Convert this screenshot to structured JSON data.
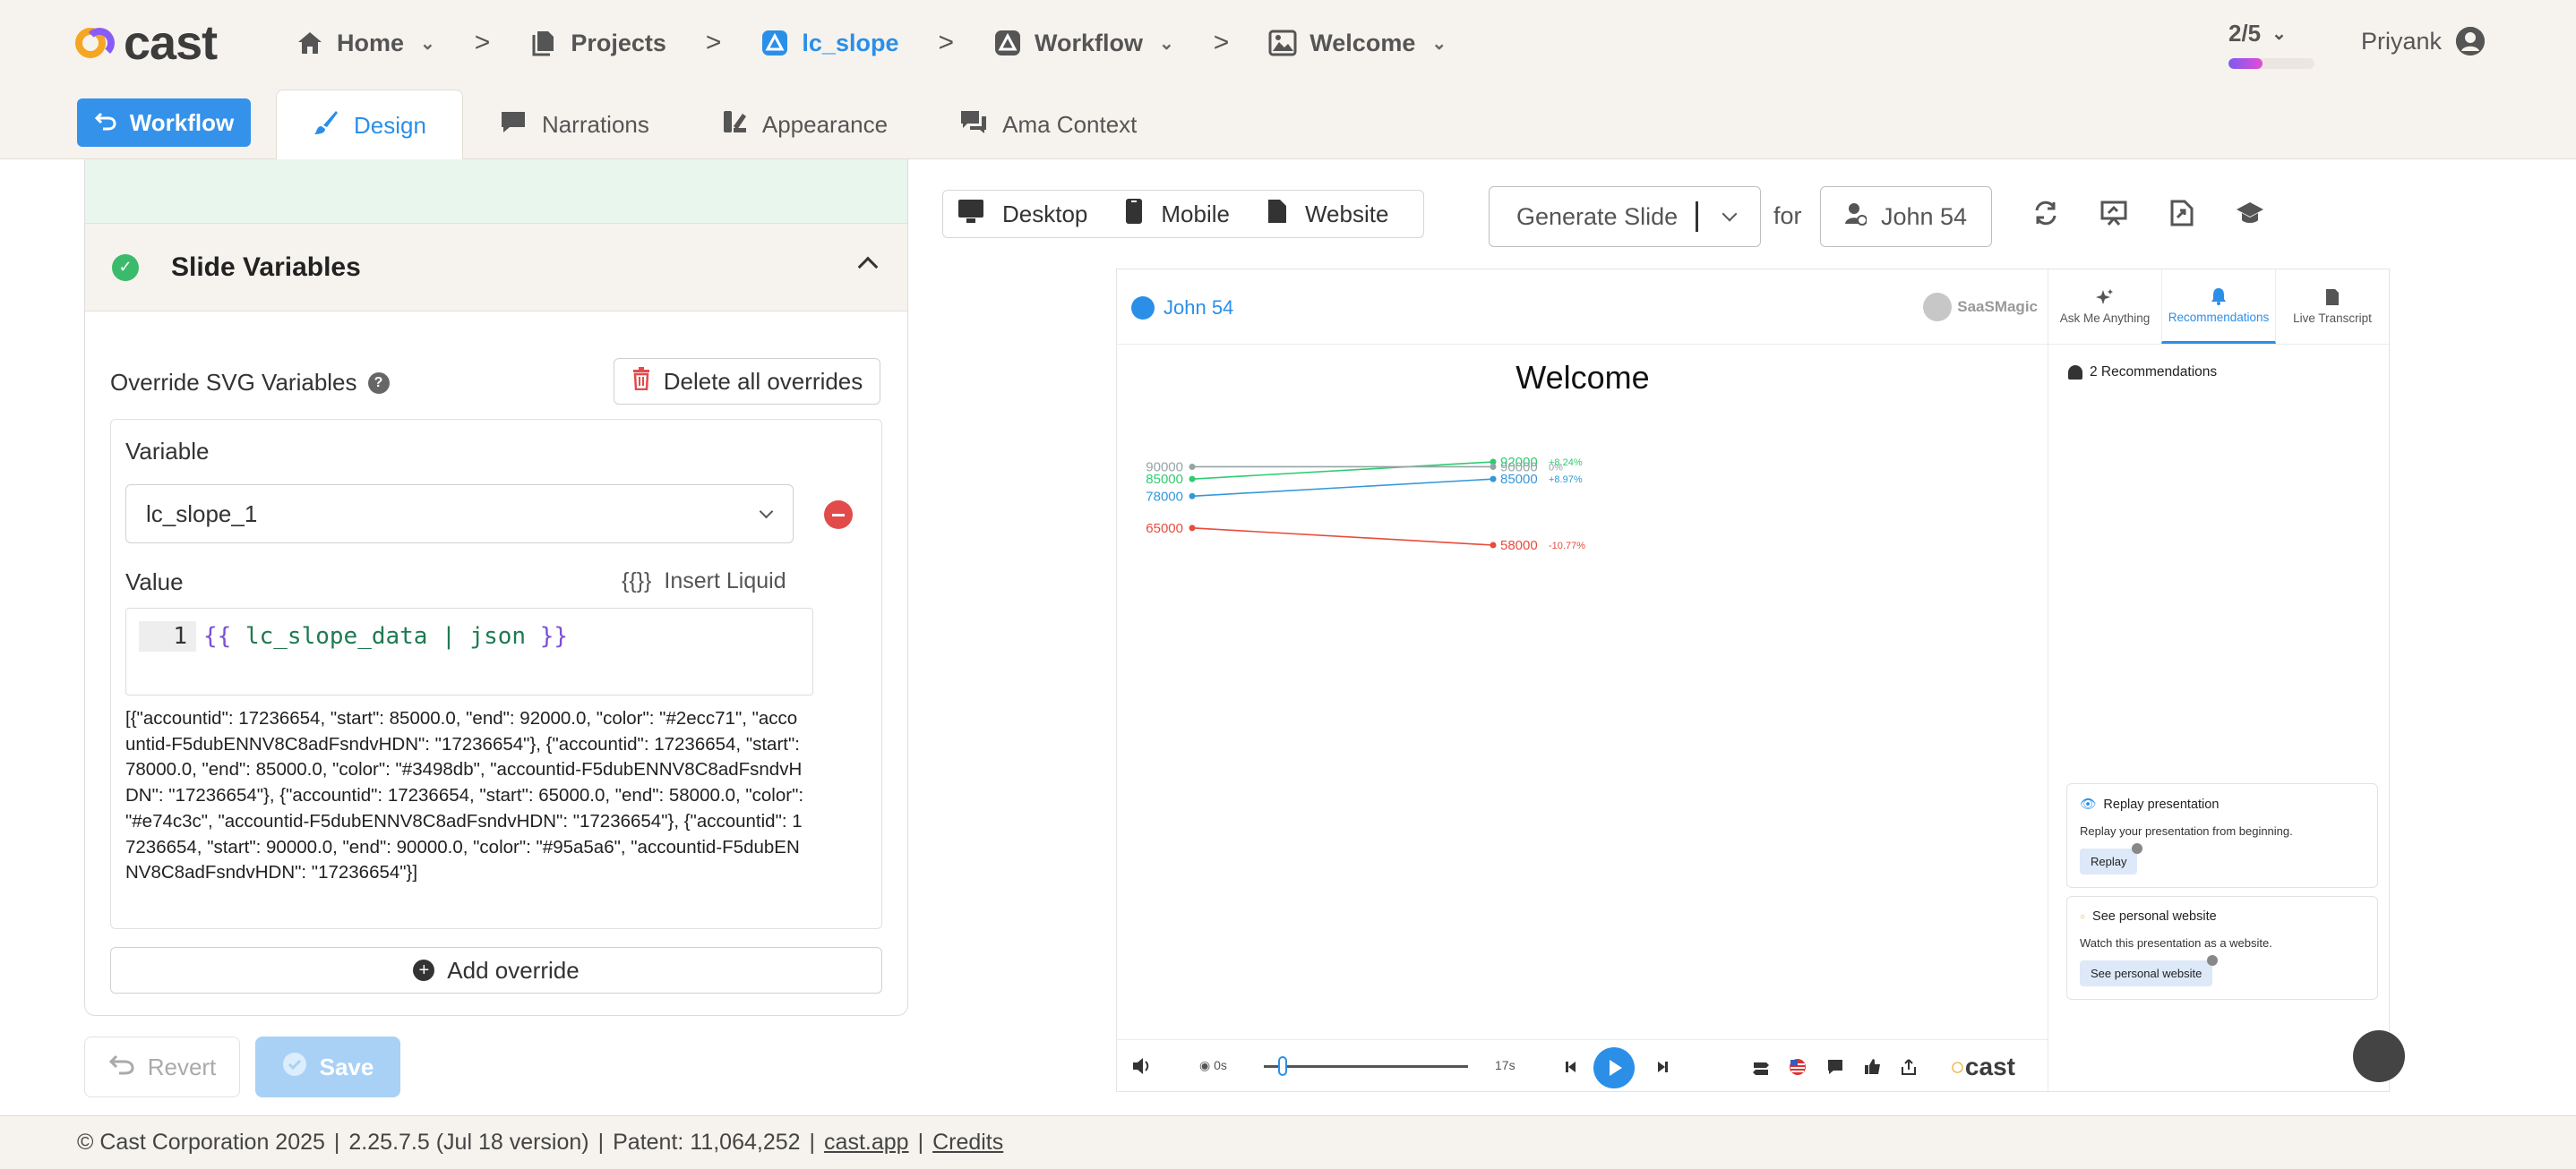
{
  "app": {
    "logo_text": "cast",
    "breadcrumbs": [
      {
        "label": "Home",
        "icon": "home-icon",
        "has_dropdown": true
      },
      {
        "label": "Projects",
        "icon": "file-icon",
        "has_dropdown": false
      },
      {
        "label": "lc_slope",
        "icon": "triangle-icon",
        "has_dropdown": false
      },
      {
        "label": "Workflow",
        "icon": "workflow-icon",
        "has_dropdown": true
      },
      {
        "label": "Welcome",
        "icon": "image-icon",
        "has_dropdown": true
      }
    ],
    "progress": {
      "label": "2/5",
      "fraction": 0.4
    },
    "user_name": "Priyank"
  },
  "tabs": {
    "workflow_button": "Workflow",
    "items": [
      "Design",
      "Narrations",
      "Appearance",
      "Ama Context"
    ],
    "active": "Design"
  },
  "left_panel": {
    "section_title": "Slide Variables",
    "override_label": "Override SVG Variables",
    "delete_all": "Delete all overrides",
    "variable_label": "Variable",
    "variable_value": "lc_slope_1",
    "value_label": "Value",
    "insert_liquid": "Insert Liquid",
    "insert_liquid_icon": "{{}}",
    "code_line_number": "1",
    "code_open": "{{",
    "code_body": " lc_slope_data | json ",
    "code_close": "}}",
    "json_output": "[{\"accountid\": 17236654, \"start\": 85000.0, \"end\": 92000.0, \"color\": \"#2ecc71\", \"accountid-F5dubENNV8C8adFsndvHDN\": \"17236654\"}, {\"accountid\": 17236654, \"start\": 78000.0, \"end\": 85000.0, \"color\": \"#3498db\", \"accountid-F5dubENNV8C8adFsndvHDN\": \"17236654\"}, {\"accountid\": 17236654, \"start\": 65000.0, \"end\": 58000.0, \"color\": \"#e74c3c\", \"accountid-F5dubENNV8C8adFsndvHDN\": \"17236654\"}, {\"accountid\": 17236654, \"start\": 90000.0, \"end\": 90000.0, \"color\": \"#95a5a6\", \"accountid-F5dubENNV8C8adFsndvHDN\": \"17236654\"}]",
    "add_override": "Add override",
    "revert": "Revert",
    "save": "Save"
  },
  "toolbar": {
    "devices": [
      "Desktop",
      "Mobile",
      "Website"
    ],
    "generate": "Generate Slide",
    "for_label": "for",
    "for_user": "John 54"
  },
  "preview": {
    "user": "John 54",
    "brand": "SaaSMagic",
    "slide_title": "Welcome",
    "side_tabs": [
      "Ask Me Anything",
      "Recommendations",
      "Live Transcript"
    ],
    "active_side_tab": "Recommendations",
    "rec_count": "2 Recommendations",
    "cards": [
      {
        "title": "Replay presentation",
        "desc": "Replay your presentation from beginning.",
        "button": "Replay"
      },
      {
        "title": "See personal website",
        "desc": "Watch this presentation as a website.",
        "button": "See personal website"
      }
    ],
    "player": {
      "start_time": "0s",
      "end_time": "17s",
      "logo": "cast"
    }
  },
  "chart_data": {
    "type": "line",
    "subtype": "slope",
    "title": "Welcome",
    "ylim": [
      55000,
      95000
    ],
    "series": [
      {
        "start": 85000,
        "end": 92000,
        "start_label": "85000",
        "end_label": "92000",
        "change": "+8.24%",
        "color": "#2ecc71"
      },
      {
        "start": 78000,
        "end": 85000,
        "start_label": "78000",
        "end_label": "85000",
        "change": "+8.97%",
        "color": "#3498db"
      },
      {
        "start": 65000,
        "end": 58000,
        "start_label": "65000",
        "end_label": "58000",
        "change": "-10.77%",
        "color": "#e74c3c"
      },
      {
        "start": 90000,
        "end": 90000,
        "start_label": "90000",
        "end_label": "90000",
        "change": "0%",
        "color": "#95a5a6"
      }
    ]
  },
  "footer": {
    "copyright": "© Cast Corporation 2025",
    "version": "2.25.7.5 (Jul 18 version)",
    "patent": "Patent: 11,064,252",
    "site": "cast.app",
    "credits": "Credits"
  }
}
